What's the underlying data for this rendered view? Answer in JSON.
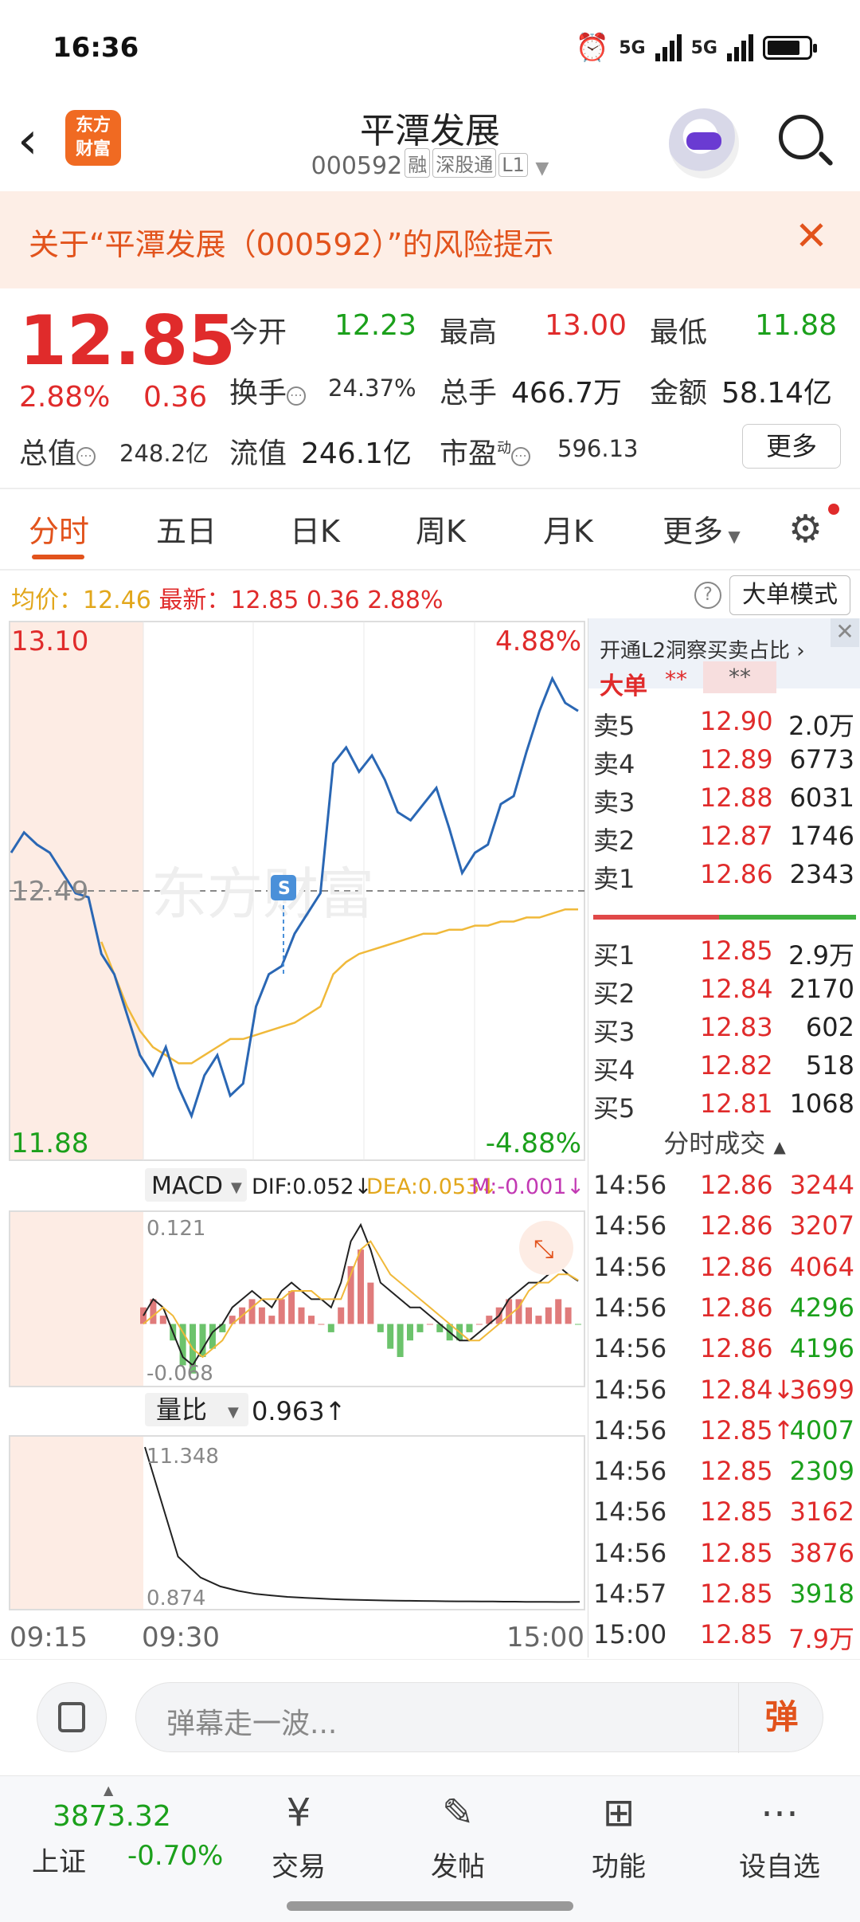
{
  "status_bar": {
    "time": "16:36",
    "network1": "5G",
    "network2": "5G"
  },
  "header": {
    "logo_text_1": "东方",
    "logo_text_2": "财富",
    "stock_name": "平潭发展",
    "stock_code": "000592",
    "tags": [
      "融",
      "深股通",
      "L1"
    ]
  },
  "risk_banner": {
    "text": "关于“平潭发展（000592）”的风险提示"
  },
  "quote": {
    "price": "12.85",
    "change_pct": "2.88%",
    "change": "0.36",
    "open_label": "今开",
    "open": "12.23",
    "high_label": "最高",
    "high": "13.00",
    "low_label": "最低",
    "low": "11.88",
    "turnover_label": "换手",
    "turnover": "24.37%",
    "volume_label": "总手",
    "volume": "466.7万",
    "amount_label": "金额",
    "amount": "58.14亿",
    "total_cap_label": "总值",
    "total_cap": "248.2亿",
    "float_cap_label": "流值",
    "float_cap": "246.1亿",
    "pe_label": "市盈",
    "pe_sup": "动",
    "pe": "596.13",
    "more_label": "更多"
  },
  "tabs": [
    {
      "label": "分时",
      "active": true
    },
    {
      "label": "五日"
    },
    {
      "label": "日K"
    },
    {
      "label": "周K"
    },
    {
      "label": "月K"
    },
    {
      "label": "更多"
    }
  ],
  "info_line": {
    "avg_label": "均价：",
    "avg_value": "12.46",
    "latest_label": "最新：",
    "latest_value": "12.85",
    "latest_change": "0.36",
    "latest_pct": "2.88%",
    "big_mode_label": "大单模式"
  },
  "chart_labels": {
    "price_top": "13.10",
    "price_mid": "12.49",
    "price_bottom": "11.88",
    "pct_top": "4.88%",
    "pct_bottom": "-4.88%",
    "macd_selector": "MACD",
    "dif": "DIF:0.052↓",
    "dea": "DEA:0.053↓",
    "m": "M:-0.001↓",
    "macd_top": "0.121",
    "macd_bottom": "-0.068",
    "vr_selector": "量比",
    "vr_value": "0.963↑",
    "vr_top": "11.348",
    "vr_bottom": "0.874",
    "time_start": "09:15",
    "time_open": "09:30",
    "time_end": "15:00",
    "watermark": "东方财富",
    "s_marker": "S"
  },
  "colors": {
    "up": "#e02b2b",
    "down": "#1ba01b",
    "price_line": "#2a67b4",
    "avg_line": "#f0b93a",
    "accent": "#e2531c",
    "preopen_bg": "#fdece4"
  },
  "chart_data": [
    {
      "type": "line",
      "name": "intraday",
      "x_range": [
        "09:15",
        "15:00"
      ],
      "ylim": [
        11.88,
        13.1
      ],
      "prev_close": 12.49,
      "series": [
        {
          "name": "price",
          "values": [
            12.6,
            12.65,
            12.62,
            12.6,
            12.55,
            12.5,
            12.49,
            12.35,
            12.3,
            12.2,
            12.1,
            12.05,
            12.12,
            12.02,
            11.95,
            12.05,
            12.1,
            12.0,
            12.03,
            12.22,
            12.3,
            12.32,
            12.4,
            12.45,
            12.5,
            12.82,
            12.86,
            12.8,
            12.84,
            12.78,
            12.7,
            12.68,
            12.72,
            12.76,
            12.66,
            12.55,
            12.6,
            12.62,
            12.72,
            12.74,
            12.85,
            12.95,
            13.03,
            12.97,
            12.95
          ]
        },
        {
          "name": "avg",
          "values": [
            null,
            null,
            null,
            null,
            null,
            null,
            null,
            12.38,
            12.3,
            12.22,
            12.16,
            12.12,
            12.1,
            12.08,
            12.08,
            12.1,
            12.12,
            12.14,
            12.14,
            12.15,
            12.16,
            12.17,
            12.18,
            12.2,
            12.22,
            12.3,
            12.33,
            12.35,
            12.36,
            12.37,
            12.38,
            12.39,
            12.4,
            12.4,
            12.41,
            12.41,
            12.42,
            12.42,
            12.43,
            12.43,
            12.44,
            12.44,
            12.45,
            12.46,
            12.46
          ]
        }
      ]
    },
    {
      "type": "bar",
      "name": "MACD",
      "ylim": [
        -0.068,
        0.121
      ],
      "series": [
        {
          "name": "M",
          "values": [
            0.02,
            0.03,
            0.01,
            -0.02,
            -0.05,
            -0.06,
            -0.04,
            -0.03,
            -0.01,
            0.01,
            0.02,
            0.03,
            0.02,
            0.01,
            0.03,
            0.04,
            0.02,
            0.01,
            0.0,
            -0.01,
            0.02,
            0.07,
            0.09,
            0.05,
            -0.01,
            -0.03,
            -0.04,
            -0.02,
            -0.01,
            0.0,
            -0.01,
            -0.02,
            -0.02,
            -0.01,
            0.0,
            0.01,
            0.02,
            0.03,
            0.03,
            0.02,
            0.01,
            0.02,
            0.03,
            0.02,
            -0.001
          ]
        },
        {
          "name": "DIF",
          "values": [
            0.01,
            0.03,
            0.02,
            -0.01,
            -0.04,
            -0.05,
            -0.03,
            -0.01,
            0.0,
            0.02,
            0.03,
            0.04,
            0.03,
            0.02,
            0.04,
            0.05,
            0.04,
            0.03,
            0.03,
            0.02,
            0.05,
            0.1,
            0.12,
            0.09,
            0.05,
            0.04,
            0.03,
            0.02,
            0.02,
            0.01,
            0.0,
            -0.01,
            -0.02,
            -0.02,
            -0.01,
            0.0,
            0.01,
            0.03,
            0.04,
            0.05,
            0.05,
            0.06,
            0.07,
            0.06,
            0.052
          ]
        },
        {
          "name": "DEA",
          "values": [
            0.0,
            0.01,
            0.02,
            0.01,
            -0.01,
            -0.03,
            -0.04,
            -0.03,
            -0.02,
            0.0,
            0.01,
            0.02,
            0.03,
            0.03,
            0.03,
            0.04,
            0.04,
            0.04,
            0.03,
            0.03,
            0.03,
            0.06,
            0.09,
            0.1,
            0.08,
            0.06,
            0.05,
            0.04,
            0.03,
            0.02,
            0.01,
            0.0,
            -0.01,
            -0.02,
            -0.02,
            -0.01,
            0.0,
            0.01,
            0.02,
            0.04,
            0.05,
            0.05,
            0.06,
            0.06,
            0.053
          ]
        }
      ]
    },
    {
      "type": "line",
      "name": "量比",
      "ylim": [
        0.874,
        11.348
      ],
      "series": [
        {
          "name": "vr",
          "values": [
            11.348,
            4.0,
            2.6,
            2.0,
            1.7,
            1.5,
            1.4,
            1.3,
            1.25,
            1.2,
            1.15,
            1.12,
            1.1,
            1.08,
            1.06,
            1.05,
            1.04,
            1.03,
            1.02,
            1.01,
            1.0,
            1.0,
            0.99,
            0.99,
            0.98,
            0.98,
            0.97,
            0.97,
            0.97,
            0.96,
            0.96,
            0.963
          ]
        }
      ]
    }
  ],
  "order_book": {
    "l2_title": "开通L2洞察买卖占比",
    "big_label": "大单",
    "big_stars1": "**",
    "big_stars2": "**",
    "asks": [
      {
        "label": "卖5",
        "price": "12.90",
        "volume": "2.0万"
      },
      {
        "label": "卖4",
        "price": "12.89",
        "volume": "6773"
      },
      {
        "label": "卖3",
        "price": "12.88",
        "volume": "6031"
      },
      {
        "label": "卖2",
        "price": "12.87",
        "volume": "1746"
      },
      {
        "label": "卖1",
        "price": "12.86",
        "volume": "2343"
      }
    ],
    "bids": [
      {
        "label": "买1",
        "price": "12.85",
        "volume": "2.9万"
      },
      {
        "label": "买2",
        "price": "12.84",
        "volume": "2170"
      },
      {
        "label": "买3",
        "price": "12.83",
        "volume": "602"
      },
      {
        "label": "买4",
        "price": "12.82",
        "volume": "518"
      },
      {
        "label": "买5",
        "price": "12.81",
        "volume": "1068"
      }
    ],
    "trades_title": "分时成交",
    "trades": [
      {
        "time": "14:56",
        "price": "12.86",
        "volume": "3244",
        "dir": "up"
      },
      {
        "time": "14:56",
        "price": "12.86",
        "volume": "3207",
        "dir": "up"
      },
      {
        "time": "14:56",
        "price": "12.86",
        "volume": "4064",
        "dir": "up"
      },
      {
        "time": "14:56",
        "price": "12.86",
        "volume": "4296",
        "dir": "down"
      },
      {
        "time": "14:56",
        "price": "12.86",
        "volume": "4196",
        "dir": "down"
      },
      {
        "time": "14:56",
        "price": "12.84↓",
        "volume": "3699",
        "dir": "up"
      },
      {
        "time": "14:56",
        "price": "12.85↑",
        "volume": "4007",
        "dir": "down"
      },
      {
        "time": "14:56",
        "price": "12.85",
        "volume": "2309",
        "dir": "down"
      },
      {
        "time": "14:56",
        "price": "12.85",
        "volume": "3162",
        "dir": "up"
      },
      {
        "time": "14:56",
        "price": "12.85",
        "volume": "3876",
        "dir": "up"
      },
      {
        "time": "14:57",
        "price": "12.85",
        "volume": "3918",
        "dir": "down"
      },
      {
        "time": "15:00",
        "price": "12.85",
        "volume": "7.9万",
        "dir": "up"
      }
    ]
  },
  "comment": {
    "placeholder": "弹幕走一波...",
    "danmu_label": "弹"
  },
  "bottom_nav": {
    "index_value": "3873.32",
    "index_name": "上证",
    "index_change": "-0.70%",
    "items": [
      {
        "label": "交易",
        "icon": "trade-icon"
      },
      {
        "label": "发帖",
        "icon": "post-icon"
      },
      {
        "label": "功能",
        "icon": "grid-icon"
      },
      {
        "label": "设自选",
        "icon": "more-icon"
      }
    ]
  }
}
